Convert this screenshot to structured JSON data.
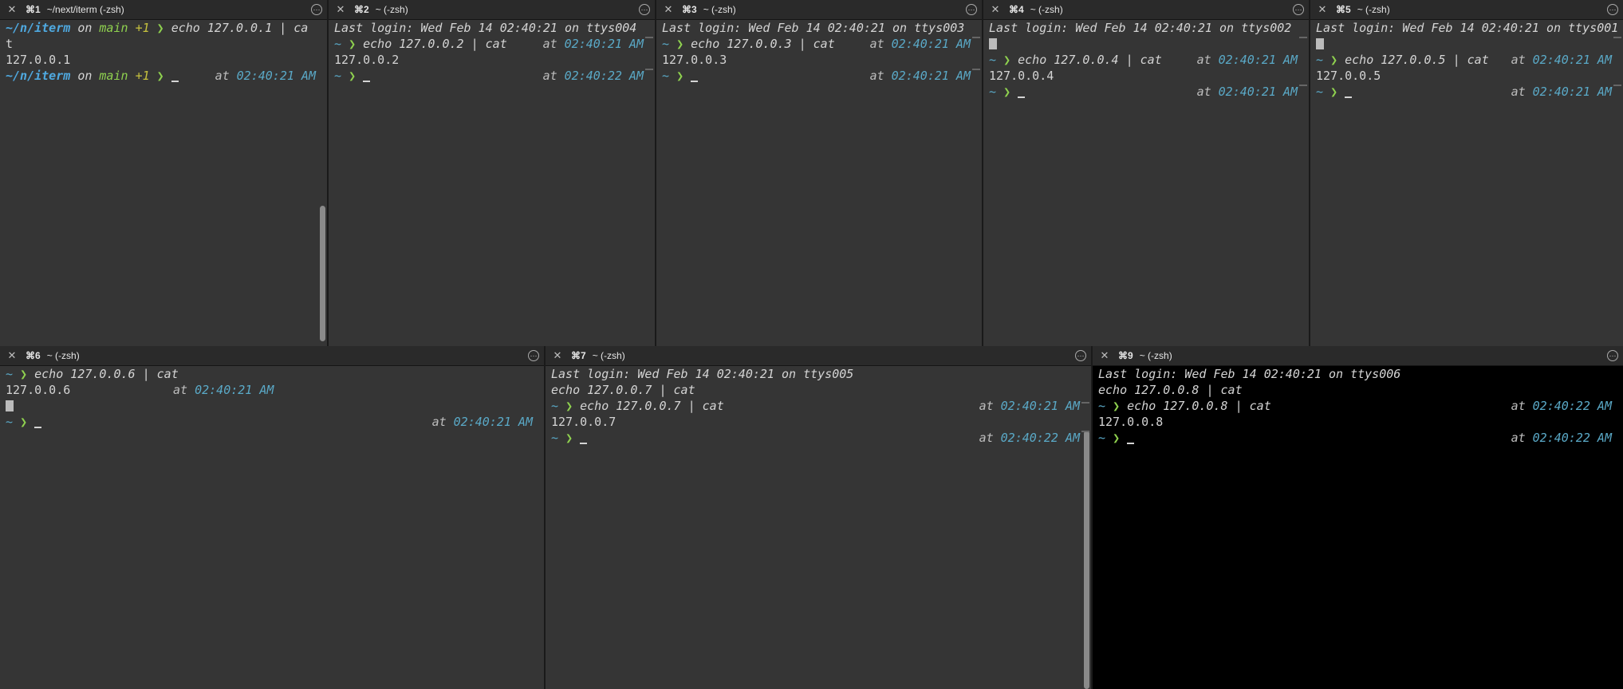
{
  "panes": [
    {
      "key": "p1",
      "tab_num": "⌘1",
      "tab_title": "~/next/iterm (-zsh)",
      "lines": [
        {
          "path": "~/n/iterm",
          "on": "on",
          "branch": "main",
          "plus": "+1",
          "cmd": "echo 127.0.0.1 | ca"
        },
        {
          "text": "t"
        },
        {
          "text": "127.0.0.1"
        },
        {
          "path": "~/n/iterm",
          "on": "on",
          "branch": "main",
          "plus": "+1",
          "cursor": true,
          "at": "at",
          "time": "02:40:21 AM"
        }
      ]
    },
    {
      "key": "p2",
      "tab_num": "⌘2",
      "tab_title": "~ (-zsh)",
      "lines": [
        {
          "text": "Last login: Wed Feb 14 02:40:21 on ttys004",
          "italic": true
        },
        {
          "prompt": "~",
          "cmd": "echo 127.0.0.2 | cat",
          "at": "at",
          "time": "02:40:21 AM"
        },
        {
          "text": "127.0.0.2"
        },
        {
          "prompt": "~",
          "cursor": true,
          "at": "at",
          "time": "02:40:22 AM"
        }
      ]
    },
    {
      "key": "p3",
      "tab_num": "⌘3",
      "tab_title": "~ (-zsh)",
      "lines": [
        {
          "text": "Last login: Wed Feb 14 02:40:21 on ttys003",
          "italic": true
        },
        {
          "prompt": "~",
          "cmd": "echo 127.0.0.3 | cat",
          "at": "at",
          "time": "02:40:21 AM"
        },
        {
          "text": "127.0.0.3"
        },
        {
          "prompt": "~",
          "cursor": true,
          "at": "at",
          "time": "02:40:21 AM"
        }
      ]
    },
    {
      "key": "p4",
      "tab_num": "⌘4",
      "tab_title": "~ (-zsh)",
      "lines": [
        {
          "text": "Last login: Wed Feb 14 02:40:21 on ttys002",
          "italic": true
        },
        {
          "glyph": true
        },
        {
          "prompt": "~",
          "cmd": "echo 127.0.0.4 | cat",
          "at": "at",
          "time": "02:40:21 AM"
        },
        {
          "text": "127.0.0.4"
        },
        {
          "prompt": "~",
          "cursor": true,
          "at": "at",
          "time": "02:40:21 AM"
        }
      ]
    },
    {
      "key": "p5",
      "tab_num": "⌘5",
      "tab_title": "~ (-zsh)",
      "lines": [
        {
          "text": "Last login: Wed Feb 14 02:40:21 on ttys001",
          "italic": true
        },
        {
          "glyph": true
        },
        {
          "prompt": "~",
          "cmd": "echo 127.0.0.5 | cat",
          "at": "at",
          "time": "02:40:21 AM"
        },
        {
          "text": "127.0.0.5"
        },
        {
          "prompt": "~",
          "cursor": true,
          "at": "at",
          "time": "02:40:21 AM"
        }
      ]
    },
    {
      "key": "p6",
      "tab_num": "⌘6",
      "tab_title": "~ (-zsh)",
      "lines": [
        {
          "prompt": "~",
          "cmd": "echo 127.0.0.6 | cat"
        },
        {
          "text": "127.0.0.6",
          "at": "at",
          "time": "02:40:21 AM",
          "inline_time": true
        },
        {
          "glyph": true
        },
        {
          "prompt": "~",
          "cursor": true,
          "at": "at",
          "time": "02:40:21 AM"
        }
      ]
    },
    {
      "key": "p7",
      "tab_num": "⌘7",
      "tab_title": "~ (-zsh)",
      "lines": [
        {
          "text": "Last login: Wed Feb 14 02:40:21 on ttys005",
          "italic": true
        },
        {
          "text": "echo 127.0.0.7 | cat",
          "italic": true
        },
        {
          "prompt": "~",
          "cmd": "echo 127.0.0.7 | cat",
          "at": "at",
          "time": "02:40:21 AM"
        },
        {
          "text": "127.0.0.7"
        },
        {
          "prompt": "~",
          "cursor": true,
          "at": "at",
          "time": "02:40:22 AM"
        }
      ]
    },
    {
      "key": "p9",
      "tab_num": "⌘9",
      "tab_title": "~ (-zsh)",
      "lines": [
        {
          "text": "Last login: Wed Feb 14 02:40:21 on ttys006",
          "italic": true
        },
        {
          "text": "echo 127.0.0.8 | cat",
          "italic": true
        },
        {
          "prompt": "~",
          "cmd": "echo 127.0.0.8 | cat",
          "at": "at",
          "time": "02:40:22 AM"
        },
        {
          "text": "127.0.0.8"
        },
        {
          "prompt": "~",
          "cursor": true,
          "at": "at",
          "time": "02:40:22 AM"
        }
      ]
    }
  ],
  "icons": {
    "close": "close-icon",
    "menu": "ellipsis-icon"
  }
}
